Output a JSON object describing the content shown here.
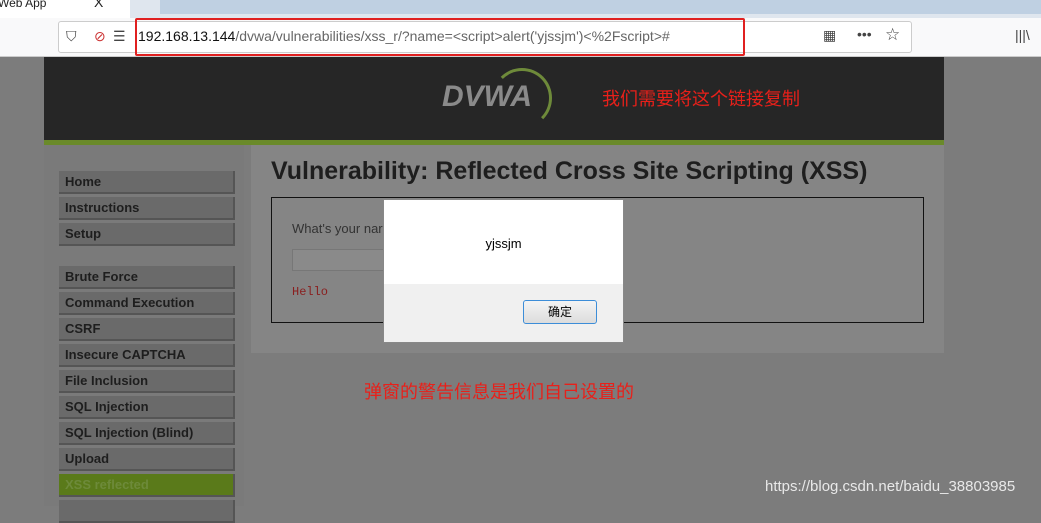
{
  "browser": {
    "tab_title": "Web App",
    "tab_close": "X",
    "url_host": "192.168.13.144",
    "url_path": "/dvwa/vulnerabilities/xss_r/?name=<script>alert('yjssjm')<%2Fscript>#"
  },
  "header": {
    "logo": "DVWA"
  },
  "annotations": {
    "top": "我们需要将这个链接复制",
    "bottom": "弹窗的警告信息是我们自己设置的"
  },
  "sidebar": {
    "items": [
      {
        "label": "Home"
      },
      {
        "label": "Instructions"
      },
      {
        "label": "Setup"
      },
      {
        "label": "Brute Force"
      },
      {
        "label": "Command Execution"
      },
      {
        "label": "CSRF"
      },
      {
        "label": "Insecure CAPTCHA"
      },
      {
        "label": "File Inclusion"
      },
      {
        "label": "SQL Injection"
      },
      {
        "label": "SQL Injection (Blind)"
      },
      {
        "label": "Upload"
      },
      {
        "label": "XSS reflected"
      }
    ]
  },
  "main": {
    "title": "Vulnerability: Reflected Cross Site Scripting (XSS)",
    "question": "What's your nar",
    "output": "Hello"
  },
  "dialog": {
    "message": "yjssjm",
    "ok_label": "确定"
  },
  "watermark": "https://blog.csdn.net/baidu_38803985"
}
